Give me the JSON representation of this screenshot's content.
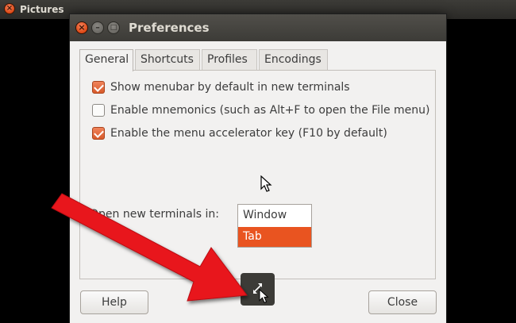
{
  "outer_window": {
    "title": "Pictures"
  },
  "dialog": {
    "title": "Preferences",
    "tabs": [
      "General",
      "Shortcuts",
      "Profiles",
      "Encodings"
    ],
    "active_tab": "General",
    "checkboxes": [
      {
        "label": "Show menubar by default in new terminals",
        "checked": true
      },
      {
        "label": "Enable mnemonics (such as Alt+F to open the File menu)",
        "checked": false
      },
      {
        "label": "Enable the menu accelerator key (F10 by default)",
        "checked": true
      }
    ],
    "open_new_terminals": {
      "label": "Open new terminals in:",
      "options": [
        "Window",
        "Tab"
      ],
      "highlighted": "Tab"
    },
    "buttons": {
      "help": "Help",
      "close": "Close"
    }
  },
  "colors": {
    "accent": "#e95420",
    "annotation_arrow": "#e8141b"
  },
  "icons": {
    "resize": "resize-arrows-icon",
    "pointer": "mouse-pointer-icon"
  }
}
